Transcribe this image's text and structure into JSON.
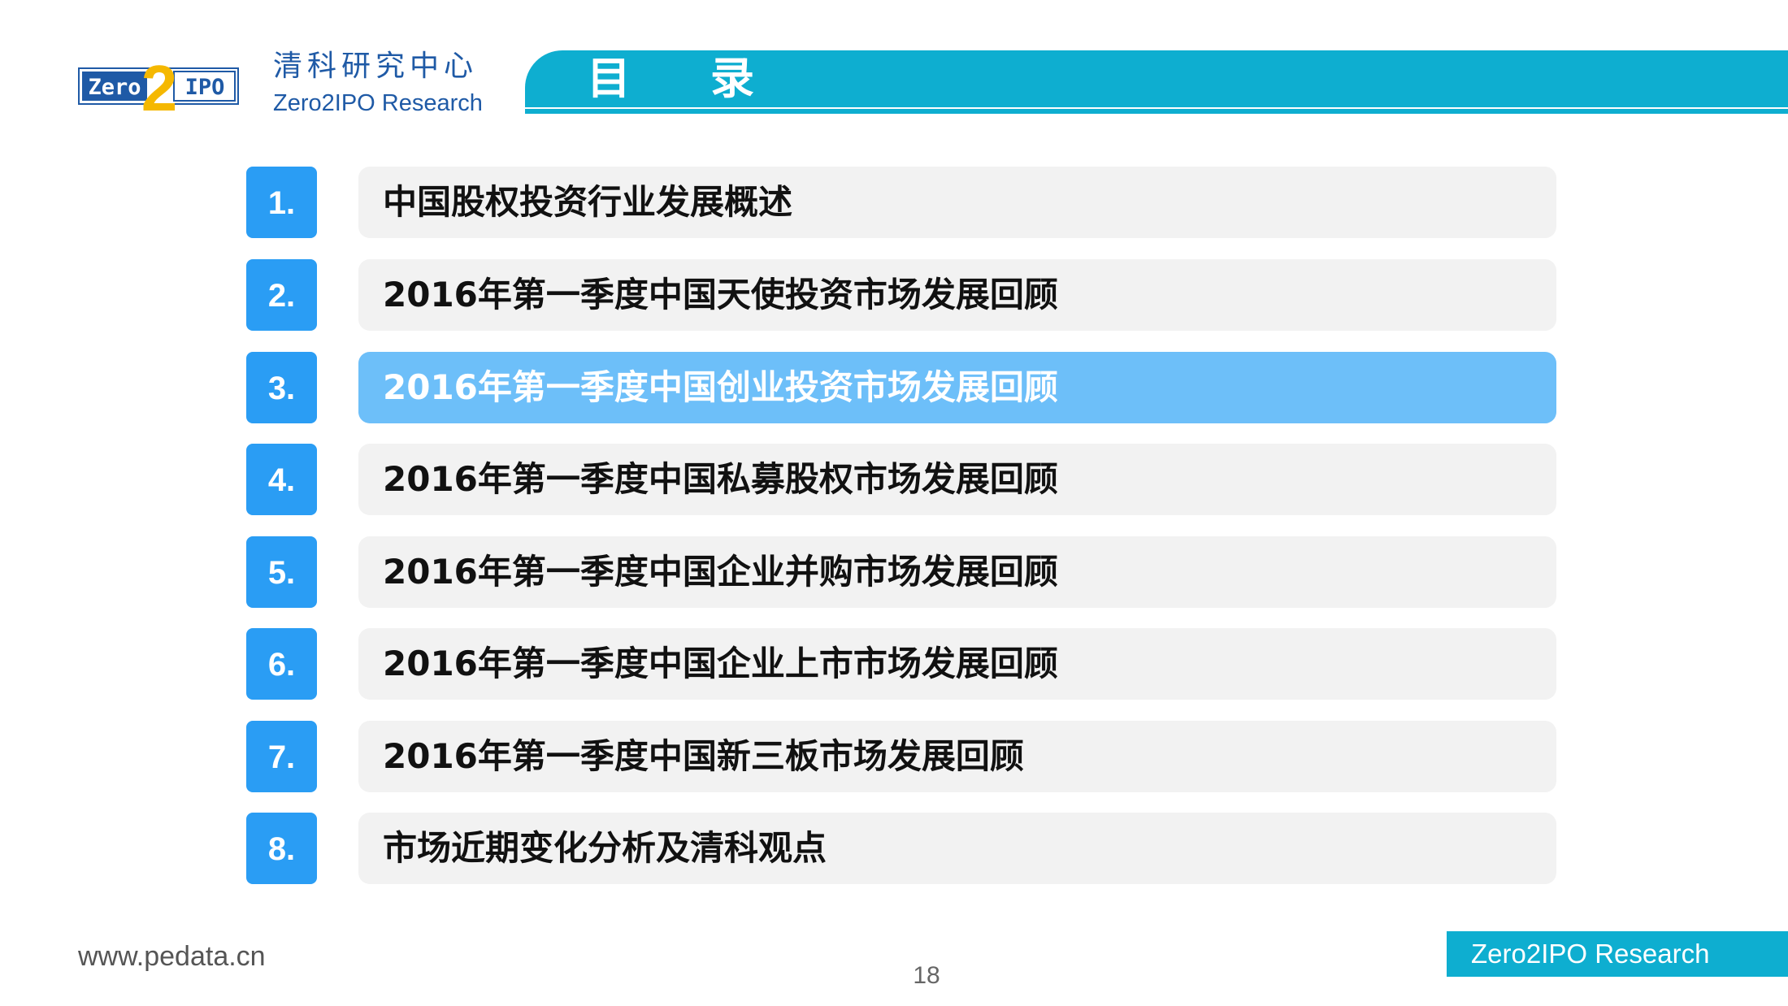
{
  "header": {
    "logo": {
      "left_text": "Zero",
      "numeral": "2",
      "right_text": "IPO",
      "colors": {
        "blue": "#1f5aa6",
        "gold": "#f5b800"
      }
    },
    "brand_cn": "清科研究中心",
    "brand_en": "Zero2IPO Research",
    "title": "目录"
  },
  "toc": {
    "items": [
      {
        "num": "1.",
        "label": "中国股权投资行业发展概述"
      },
      {
        "num": "2.",
        "label": "2016年第一季度中国天使投资市场发展回顾"
      },
      {
        "num": "3.",
        "label": "2016年第一季度中国创业投资市场发展回顾"
      },
      {
        "num": "4.",
        "label": "2016年第一季度中国私募股权市场发展回顾"
      },
      {
        "num": "5.",
        "label": "2016年第一季度中国企业并购市场发展回顾"
      },
      {
        "num": "6.",
        "label": "2016年第一季度中国企业上市市场发展回顾"
      },
      {
        "num": "7.",
        "label": "2016年第一季度中国新三板市场发展回顾"
      },
      {
        "num": "8.",
        "label": "市场近期变化分析及清科观点"
      }
    ],
    "active_index": 2
  },
  "footer": {
    "url": "www.pedata.cn",
    "page_number": "18",
    "brand": "Zero2IPO Research"
  },
  "colors": {
    "accent": "#0eaed0",
    "number_box": "#2a9df4",
    "active_bar": "#6dbff9",
    "bar": "#f2f2f2"
  }
}
